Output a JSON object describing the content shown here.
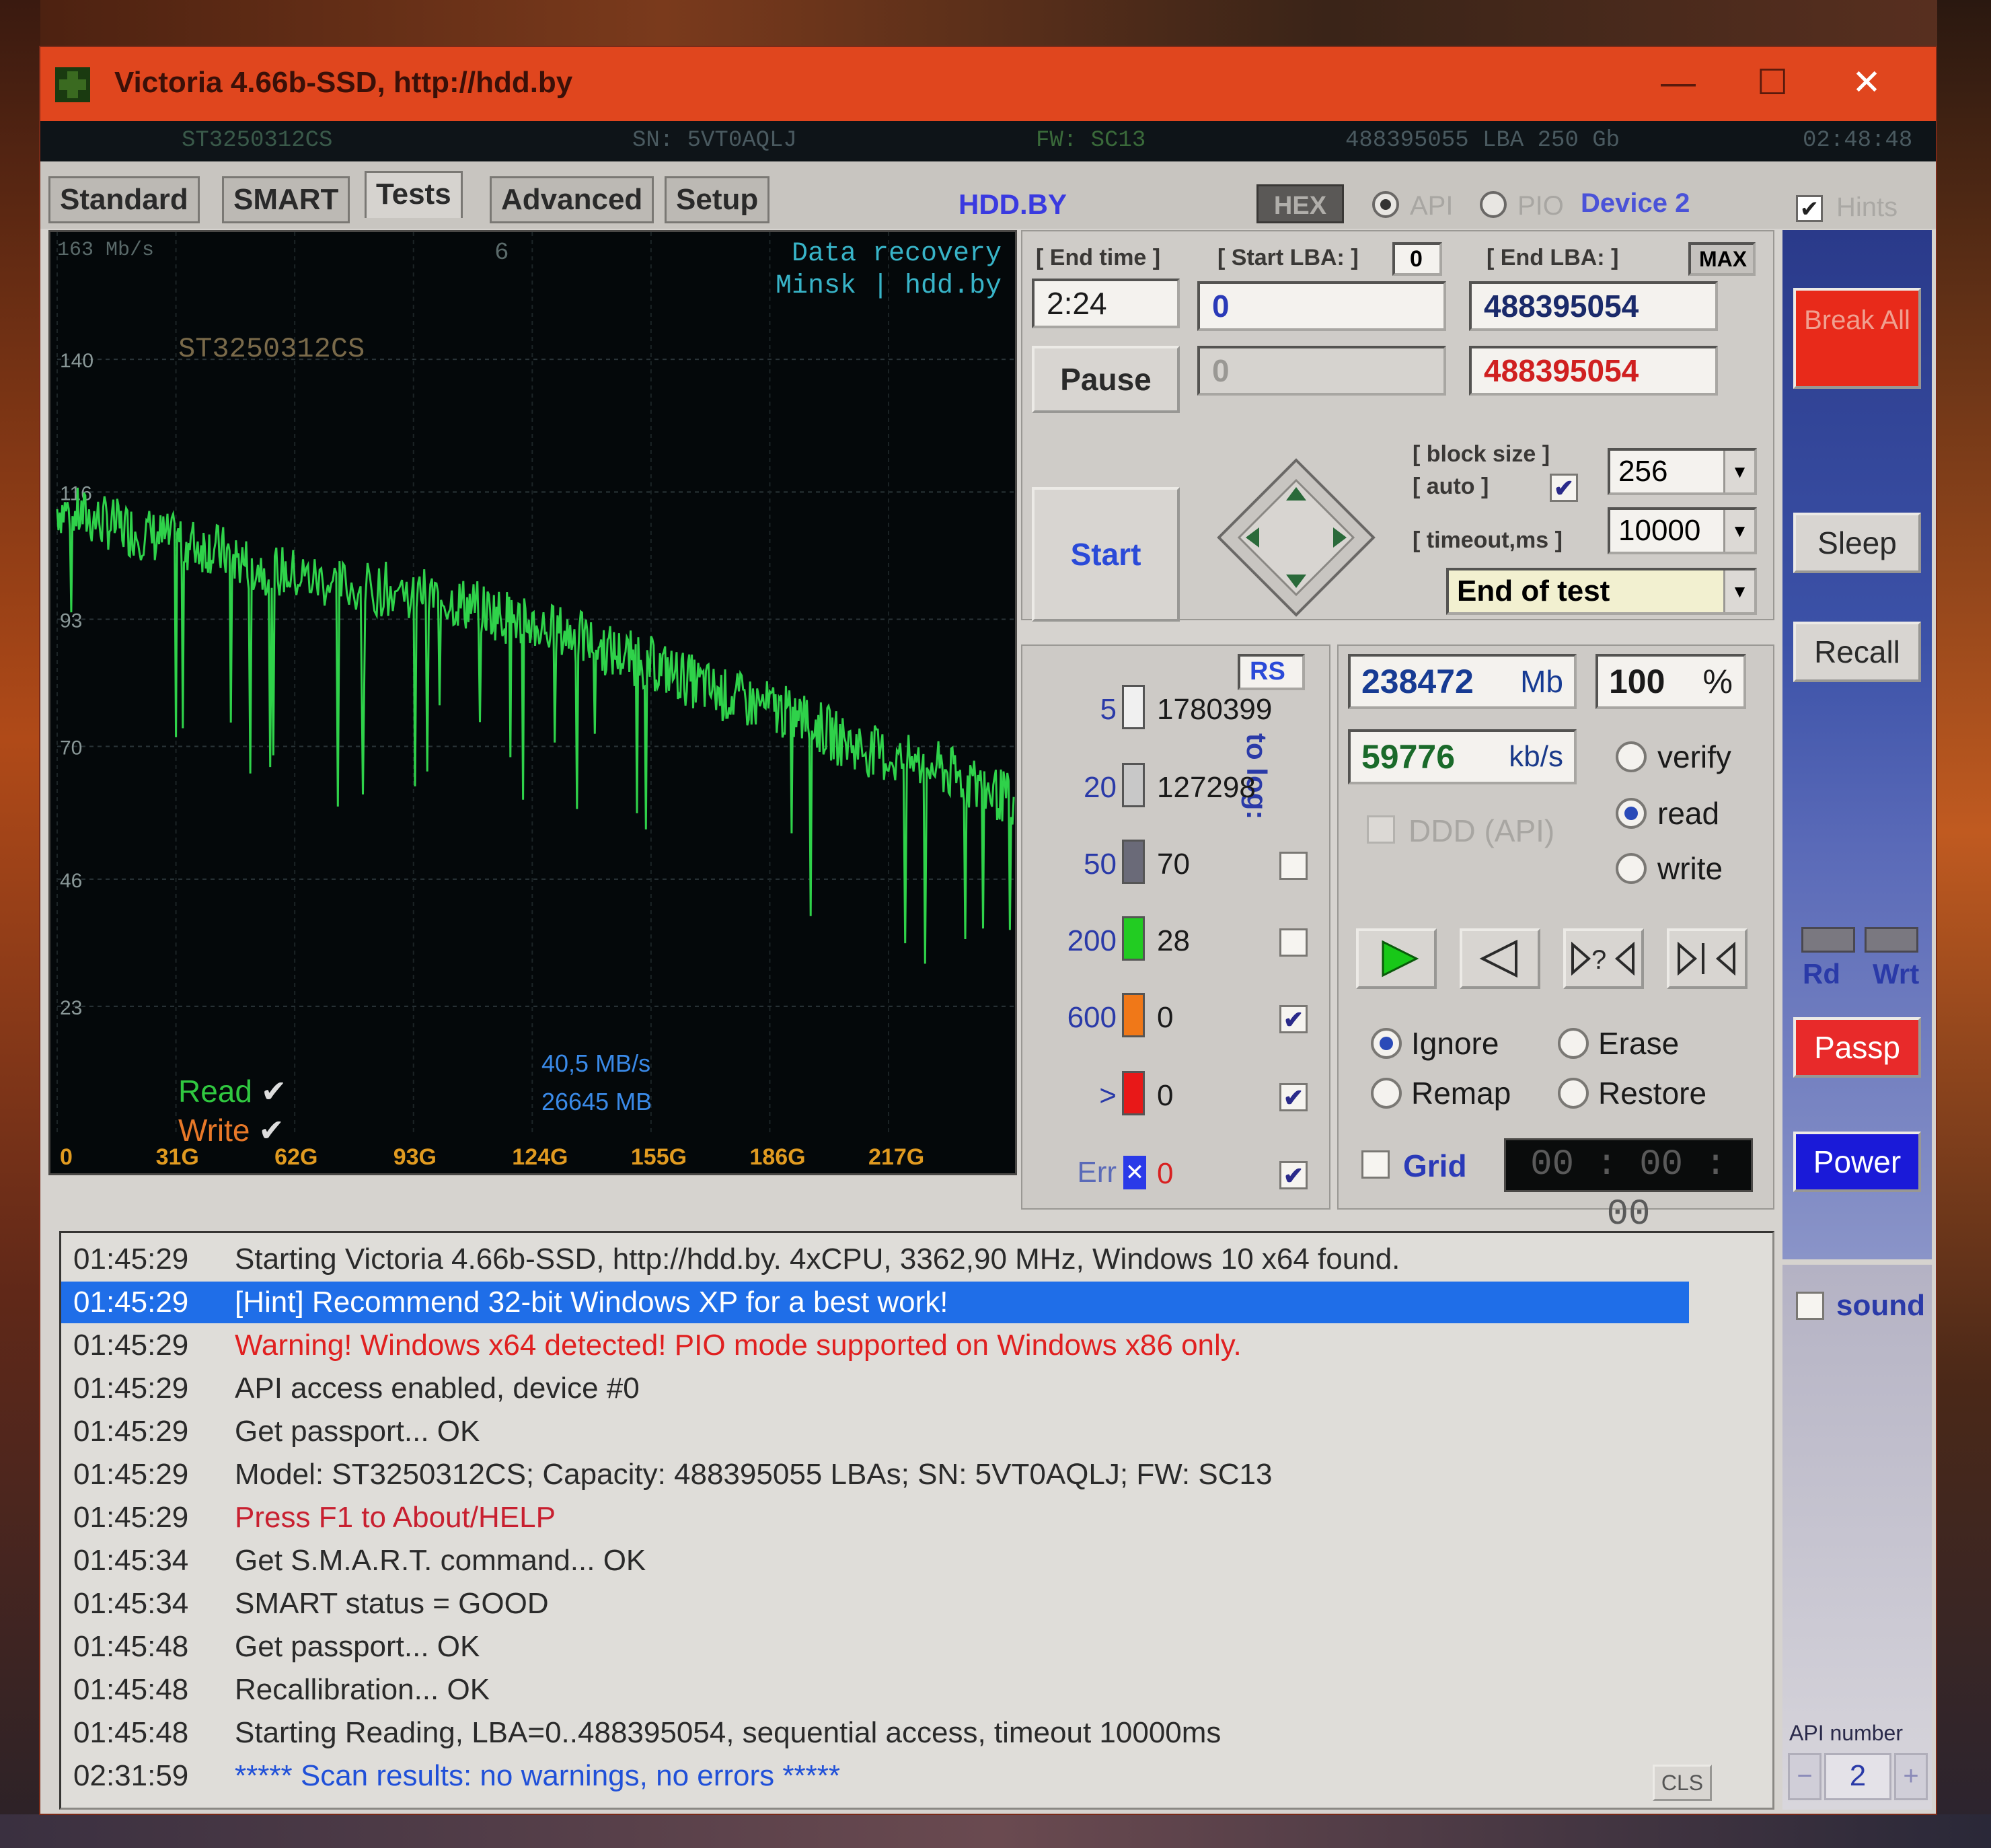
{
  "window": {
    "title": "Victoria 4.66b-SSD, http://hdd.by",
    "minimize": "—",
    "maximize": "☐",
    "close": "✕"
  },
  "infobar": {
    "model": "ST3250312CS",
    "sn": "SN: 5VT0AQLJ",
    "fw": "FW: SC13",
    "lba": "488395055 LBA  250 Gb",
    "time": "02:48:48"
  },
  "tabs": [
    "Standard",
    "SMART",
    "Tests",
    "Advanced",
    "Setup"
  ],
  "toolbar": {
    "hddby": "HDD.BY",
    "hex": "HEX",
    "api": "API",
    "pio": "PIO",
    "device": "Device 2",
    "hints": "Hints"
  },
  "graph": {
    "unit_label": "163  Mb/s",
    "page_num": "6",
    "watermark_line1": "Data  recovery",
    "watermark_line2": "Minsk | hdd.by",
    "drive_model": "ST3250312CS",
    "y_ticks": [
      "140",
      "116",
      "93",
      "70",
      "46",
      "23"
    ],
    "x_ticks": [
      "0",
      "31G",
      "62G",
      "93G",
      "124G",
      "155G",
      "186G",
      "217G"
    ],
    "read_label": "Read",
    "write_label": "Write",
    "speed": "40,5 MB/s",
    "size": "26645 MB"
  },
  "chart_data": {
    "type": "line",
    "title": "",
    "xlabel": "",
    "ylabel": "",
    "ylim": [
      0,
      163
    ],
    "xlim_gb": [
      0,
      250
    ],
    "series": [
      {
        "name": "Read",
        "color": "#2fd24a",
        "x": [
          0,
          10,
          20,
          31,
          40,
          50,
          62,
          75,
          93,
          105,
          115,
          124,
          135,
          145,
          155,
          165,
          175,
          186,
          195,
          205,
          217,
          230,
          240,
          250
        ],
        "y": [
          113,
          111,
          109,
          107,
          106,
          103,
          101,
          99,
          98,
          96,
          94,
          92,
          90,
          87,
          85,
          82,
          79,
          77,
          75,
          71,
          68,
          66,
          63,
          60
        ]
      }
    ]
  },
  "controls": {
    "end_time_label": "[ End time ]",
    "end_time": "2:24",
    "start_lba_label": "[ Start LBA: ]",
    "start_lba_zero": "0",
    "end_lba_label": "[ End LBA: ]",
    "max_label": "MAX",
    "start_lba": "0",
    "end_lba": "488395054",
    "cur_lba_start": "0",
    "cur_lba_end": "488395054",
    "pause": "Pause",
    "start": "Start",
    "block_size_label": "[ block size ]",
    "auto_label": "[ auto ]",
    "block_size": "256",
    "timeout_label": "[ timeout,ms ]",
    "timeout": "10000",
    "end_action": "End of test"
  },
  "stats": {
    "rs": "RS",
    "to_log": "to log:",
    "rows": [
      {
        "thr": "5",
        "count": "1780399",
        "color": "#f0f0f0"
      },
      {
        "thr": "20",
        "count": "127298",
        "color": "#c8c8c8"
      },
      {
        "thr": "50",
        "count": "70",
        "color": "#6a6a78"
      },
      {
        "thr": "200",
        "count": "28",
        "color": "#22cc22"
      },
      {
        "thr": "600",
        "count": "0",
        "color": "#f07818"
      },
      {
        "thr": ">",
        "count": "0",
        "color": "#e81818"
      }
    ],
    "err_label": "Err",
    "err_count": "0"
  },
  "progress": {
    "mb": "238472",
    "mb_unit": "Mb",
    "percent": "100",
    "pct_unit": "%",
    "speed": "59776",
    "speed_unit": "kb/s",
    "ddd": "DDD (API)"
  },
  "modes": {
    "verify": "verify",
    "read": "read",
    "write": "write"
  },
  "actions": {
    "ignore": "Ignore",
    "erase": "Erase",
    "remap": "Remap",
    "restore": "Restore",
    "grid": "Grid",
    "timer": "00 : 00 : 00"
  },
  "sidebar": {
    "break": "Break All",
    "sleep": "Sleep",
    "recall": "Recall",
    "rd": "Rd",
    "wrt": "Wrt",
    "passp": "Passp",
    "power": "Power",
    "sound": "sound",
    "api_number_label": "API number",
    "api_number": "2",
    "minus": "−",
    "plus": "+"
  },
  "log": [
    {
      "time": "01:45:29",
      "msg": "Starting Victoria 4.66b-SSD, http://hdd.by. 4xCPU, 3362,90 MHz, Windows 10 x64 found.",
      "color": "#2a2a2a"
    },
    {
      "time": "01:45:29",
      "msg": "[Hint] Recommend 32-bit Windows XP for a best work!",
      "color": "#ffffff",
      "highlight": true
    },
    {
      "time": "01:45:29",
      "msg": "Warning! Windows x64 detected! PIO mode supported on Windows x86 only.",
      "color": "#e02020"
    },
    {
      "time": "01:45:29",
      "msg": "API access enabled, device #0",
      "color": "#2a2a2a"
    },
    {
      "time": "01:45:29",
      "msg": "Get passport... OK",
      "color": "#2a2a2a"
    },
    {
      "time": "01:45:29",
      "msg": "Model: ST3250312CS; Capacity: 488395055 LBAs; SN: 5VT0AQLJ; FW: SC13",
      "color": "#2a2a2a"
    },
    {
      "time": "01:45:29",
      "msg": "Press F1 to About/HELP",
      "color": "#c82030"
    },
    {
      "time": "01:45:34",
      "msg": "Get S.M.A.R.T. command... OK",
      "color": "#2a2a2a"
    },
    {
      "time": "01:45:34",
      "msg": "SMART status = GOOD",
      "color": "#2a2a2a"
    },
    {
      "time": "01:45:48",
      "msg": "Get passport... OK",
      "color": "#2a2a2a"
    },
    {
      "time": "01:45:48",
      "msg": "Recallibration... OK",
      "color": "#2a2a2a"
    },
    {
      "time": "01:45:48",
      "msg": "Starting Reading, LBA=0..488395054, sequential access, timeout 10000ms",
      "color": "#2a2a2a"
    },
    {
      "time": "02:31:59",
      "msg": "***** Scan results: no warnings, no errors *****",
      "color": "#2050d8"
    }
  ],
  "cls": "CLS"
}
